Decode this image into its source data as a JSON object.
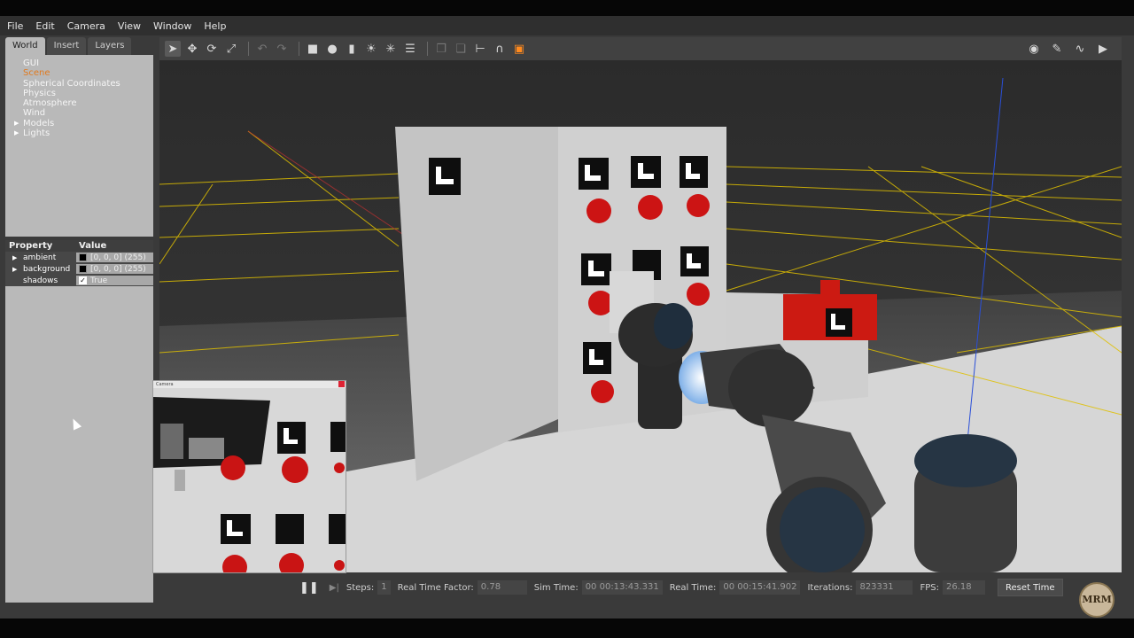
{
  "menubar": {
    "items": [
      "File",
      "Edit",
      "Camera",
      "View",
      "Window",
      "Help"
    ]
  },
  "left_panel": {
    "tabs": [
      "World",
      "Insert",
      "Layers"
    ],
    "active_tab": "World",
    "tree": [
      {
        "label": "GUI",
        "expandable": false,
        "selected": false
      },
      {
        "label": "Scene",
        "expandable": false,
        "selected": true
      },
      {
        "label": "Spherical Coordinates",
        "expandable": false,
        "selected": false
      },
      {
        "label": "Physics",
        "expandable": false,
        "selected": false
      },
      {
        "label": "Atmosphere",
        "expandable": false,
        "selected": false
      },
      {
        "label": "Wind",
        "expandable": false,
        "selected": false
      },
      {
        "label": "Models",
        "expandable": true,
        "selected": false
      },
      {
        "label": "Lights",
        "expandable": true,
        "selected": false
      }
    ],
    "properties": {
      "header_property": "Property",
      "header_value": "Value",
      "rows": [
        {
          "name": "ambient",
          "value": "[0, 0, 0] (255)",
          "type": "color"
        },
        {
          "name": "background",
          "value": "[0, 0, 0] (255)",
          "type": "color"
        },
        {
          "name": "shadows",
          "value": "True",
          "type": "bool"
        }
      ]
    }
  },
  "toolbar": {
    "tools": [
      "select-mode",
      "translate-mode",
      "rotate-mode",
      "scale-mode",
      "undo",
      "redo",
      "box-shape",
      "sphere-shape",
      "cylinder-shape",
      "point-light",
      "spot-light",
      "directional-light",
      "copy",
      "paste",
      "align",
      "snap",
      "change-view"
    ],
    "right_tools": [
      "screenshot",
      "log-data",
      "plot",
      "video-record"
    ]
  },
  "camera_window": {
    "title": "Camera"
  },
  "statusbar": {
    "steps_label": "Steps:",
    "steps_value": "1",
    "rtf_label": "Real Time Factor:",
    "rtf_value": "0.78",
    "sim_time_label": "Sim Time:",
    "sim_time_value": "00 00:13:43.331",
    "real_time_label": "Real Time:",
    "real_time_value": "00 00:15:41.902",
    "iterations_label": "Iterations:",
    "iterations_value": "823331",
    "fps_label": "FPS:",
    "fps_value": "26.18",
    "reset_label": "Reset Time"
  },
  "logo": {
    "text": "MRM"
  },
  "colors": {
    "selected_tree_item": "#e07a1f",
    "grid": "#e0c000",
    "button_red": "#cc1414"
  }
}
